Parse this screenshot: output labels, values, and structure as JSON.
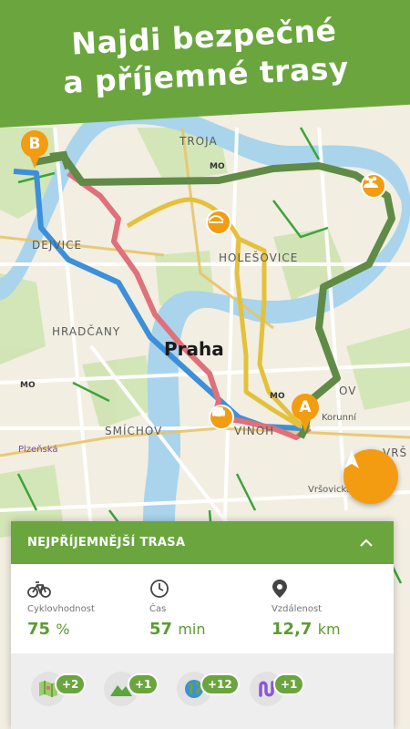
{
  "header": {
    "line1": "Najdi bezpečné",
    "line2": "a příjemné trasy"
  },
  "map": {
    "labels": {
      "troja": "TROJA",
      "dejvice": "DEJVICE",
      "holesovice": "HOLEŠOVICE",
      "hradcany": "HRADČANY",
      "praha": "Praha",
      "smichov": "SMÍCHOV",
      "vinohrady": "VINOH",
      "korunni": "Korunní",
      "plzenska": "Plzeňská",
      "vrsovicka": "Vršovická",
      "vrs": "VRŠ",
      "ov": "OV",
      "mo1": "MO",
      "mo2": "MO",
      "mo3": "MO"
    },
    "pins": {
      "start": "A",
      "end": "B"
    },
    "colors": {
      "route_green": "#5f8b46",
      "route_yellow": "#e3c13b",
      "route_red": "#e0707a",
      "route_blue": "#3d8fd9",
      "water": "#a9d4ec",
      "accent": "#f39c12"
    }
  },
  "card": {
    "title": "NEJPŘÍJEMNĚJŠÍ TRASA",
    "stats": [
      {
        "icon": "bicycle-icon",
        "label": "Cyklovhodnost",
        "value": "75",
        "unit": "%"
      },
      {
        "icon": "clock-icon",
        "label": "Čas",
        "value": "57",
        "unit": "min"
      },
      {
        "icon": "location-pin-icon",
        "label": "Vzdálenost",
        "value": "12,7",
        "unit": "km"
      }
    ],
    "badges": [
      {
        "icon": "map-icon",
        "count": "+2"
      },
      {
        "icon": "mountain-icon",
        "count": "+1"
      },
      {
        "icon": "globe-icon",
        "count": "+12"
      },
      {
        "icon": "route-icon",
        "count": "+1"
      }
    ]
  }
}
